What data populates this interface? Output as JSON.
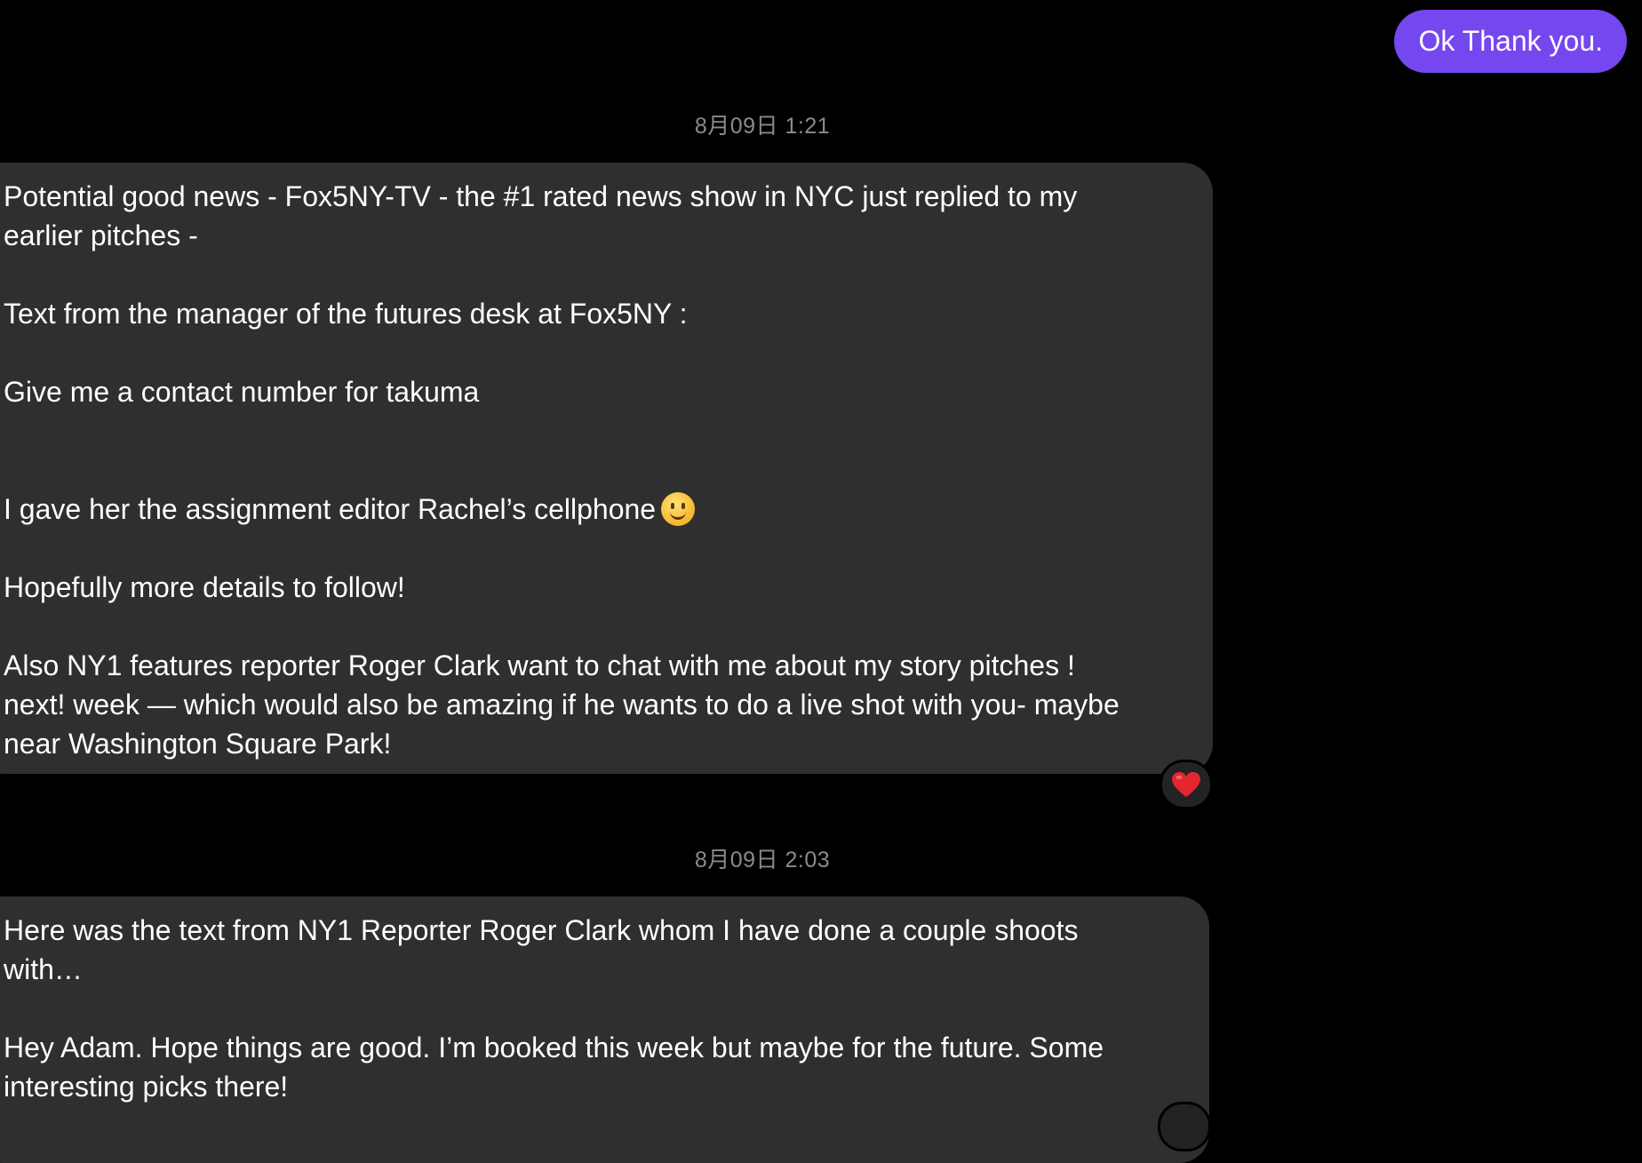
{
  "colors": {
    "background": "#000000",
    "sent_bubble": "#7547ef",
    "received_bubble": "#2f2f2f",
    "timestamp_text": "#8b8b8b",
    "reaction_bg": "#232323",
    "heart": "#e3262f"
  },
  "sent_message": {
    "text": "Ok Thank you."
  },
  "messages": [
    {
      "timestamp": "8月09日 1:21",
      "lines": [
        "Potential good news - Fox5NY-TV - the #1 rated news show in NYC just replied to my",
        "earlier pitches -",
        "Text from the manager of the futures desk at Fox5NY :",
        "Give me a contact number for takuma",
        "I gave her the assignment editor Rachel’s cellphone",
        "Hopefully more details to follow!",
        "Also NY1 features reporter Roger Clark want to chat with me about my story pitches !",
        "next! week — which would also be amazing if he wants to do a live shot with you- maybe",
        "near Washington Square Park!"
      ],
      "emoji": "slightly-smiling-face",
      "reaction": "red-heart"
    },
    {
      "timestamp": "8月09日 2:03",
      "lines": [
        "Here was the text from NY1 Reporter Roger Clark whom I have done a couple shoots",
        "with…",
        "Hey Adam. Hope things are good. I’m booked this week but maybe for the future. Some",
        "interesting picks there!"
      ]
    }
  ]
}
